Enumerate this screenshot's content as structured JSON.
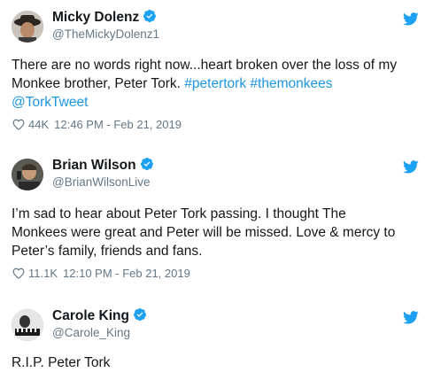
{
  "accent": "#1b95e0",
  "tweets": [
    {
      "name": "Micky Dolenz",
      "handle": "@TheMickyDolenz1",
      "avatar_icon": "avatar-photo-hat",
      "verified": true,
      "text_plain": "There are no words right now...heart broken over the loss of my Monkee brother, Peter Tork. ",
      "hashtag1": "#petertork",
      "hashtag2": "#themonkees",
      "mention": "@TorkTweet",
      "likes": "44K",
      "time": "12:46 PM - Feb 21, 2019"
    },
    {
      "name": "Brian Wilson",
      "handle": "@BrianWilsonLive",
      "avatar_icon": "avatar-photo-microphone",
      "verified": true,
      "line1": "I’m sad to hear about Peter Tork passing. I thought The",
      "line2": "Monkees were great and Peter will be missed. Love & mercy to",
      "line3": "Peter’s family, friends and fans.",
      "likes": "11.1K",
      "time": "12:10 PM - Feb 21, 2019"
    },
    {
      "name": "Carole King",
      "handle": "@Carole_King",
      "avatar_icon": "avatar-photo-piano",
      "verified": true,
      "text": "R.I.P. Peter Tork"
    }
  ]
}
